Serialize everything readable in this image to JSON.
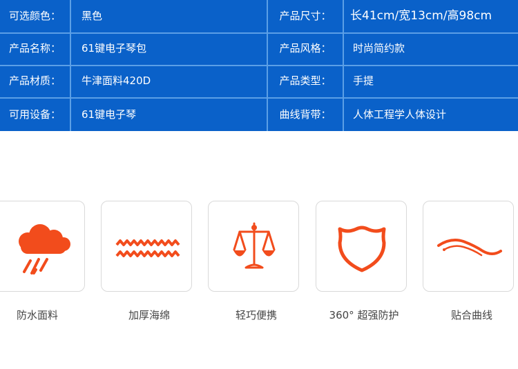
{
  "specs": {
    "rows": [
      {
        "label1": "可选颜色：",
        "value1": "黑色",
        "label2": "产品尺寸：",
        "value2": "长41cm/宽13cm/高98cm"
      },
      {
        "label1": "产品名称：",
        "value1": "61键电子琴包",
        "label2": "产品风格：",
        "value2": "时尚简约款"
      },
      {
        "label1": "产品材质：",
        "value1": "牛津面料420D",
        "label2": "产品类型：",
        "value2": "手提"
      },
      {
        "label1": "可用设备：",
        "value1": "61键电子琴",
        "label2": "曲线背带：",
        "value2": "人体工程学人体设计"
      }
    ]
  },
  "features": [
    {
      "icon": "rain-cloud-icon",
      "caption": "防水面料"
    },
    {
      "icon": "wavy-lines-icon",
      "caption": "加厚海绵"
    },
    {
      "icon": "balance-scale-icon",
      "caption": "轻巧便携"
    },
    {
      "icon": "shield-icon",
      "caption": "360°  超强防护"
    },
    {
      "icon": "curve-strap-icon",
      "caption": "贴合曲线"
    }
  ],
  "colors": {
    "table_bg": "#0a61c9",
    "grid_line": "#5b9fe6",
    "icon_orange": "#f24c1c",
    "caption_text": "#444444",
    "card_border": "#d9d9d9"
  }
}
